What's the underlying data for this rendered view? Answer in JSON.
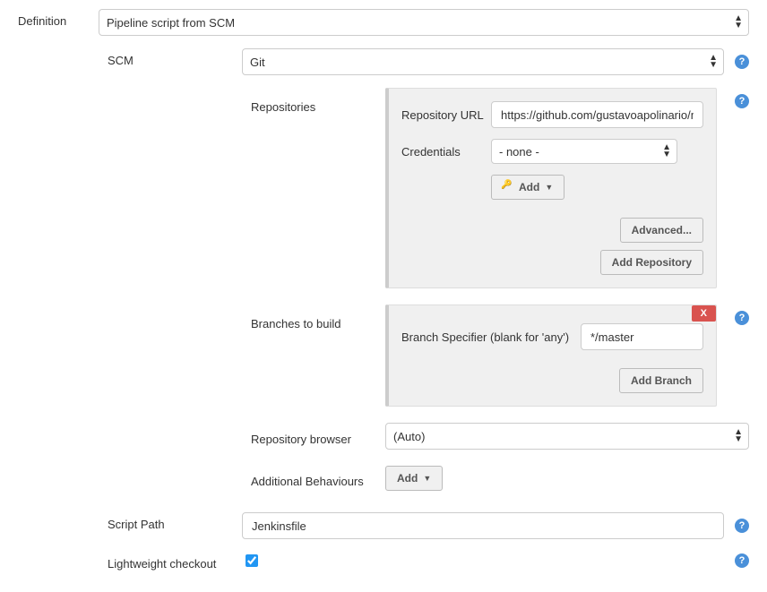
{
  "definition": {
    "label": "Definition",
    "value": "Pipeline script from SCM"
  },
  "scm": {
    "label": "SCM",
    "value": "Git",
    "repositories": {
      "label": "Repositories",
      "repo_url_label": "Repository URL",
      "repo_url_value": "https://github.com/gustavoapolinario/microservice-example",
      "credentials_label": "Credentials",
      "credentials_value": "- none -",
      "add_cred_label": "Add",
      "advanced_label": "Advanced...",
      "add_repo_label": "Add Repository"
    },
    "branches": {
      "label": "Branches to build",
      "specifier_label": "Branch Specifier (blank for 'any')",
      "specifier_value": "*/master",
      "add_branch_label": "Add Branch",
      "close_label": "X"
    },
    "repo_browser": {
      "label": "Repository browser",
      "value": "(Auto)"
    },
    "behaviours": {
      "label": "Additional Behaviours",
      "add_label": "Add"
    }
  },
  "script_path": {
    "label": "Script Path",
    "value": "Jenkinsfile"
  },
  "lightweight": {
    "label": "Lightweight checkout",
    "checked": true
  },
  "help_tooltip": "?"
}
